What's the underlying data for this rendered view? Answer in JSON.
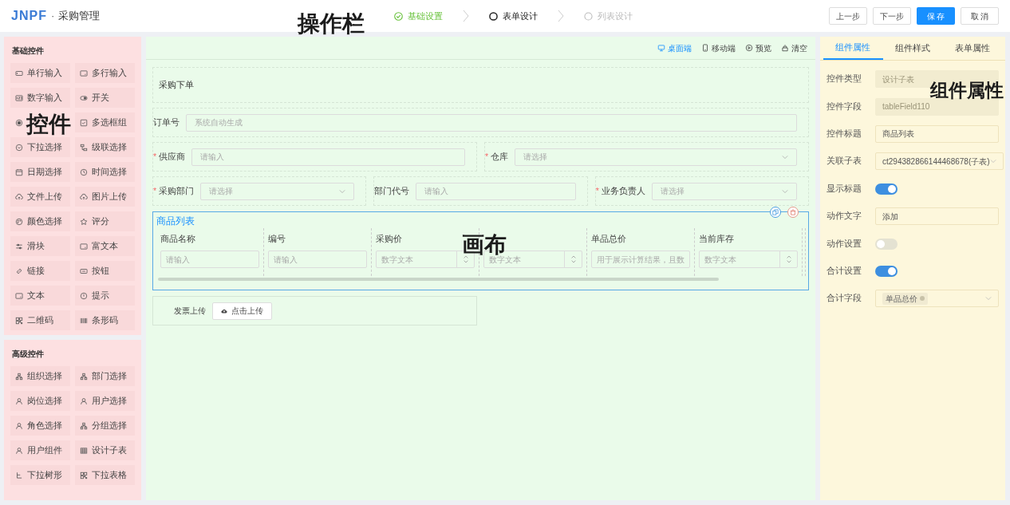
{
  "header": {
    "logo": "JNPF",
    "separator": "·",
    "title": "采购管理",
    "steps": [
      {
        "label": "基础设置",
        "done": true,
        "selected": false
      },
      {
        "label": "表单设计",
        "done": false,
        "selected": true
      },
      {
        "label": "列表设计",
        "done": false,
        "selected": false
      }
    ],
    "buttons": [
      {
        "label": "上一步",
        "primary": false
      },
      {
        "label": "下一步",
        "primary": false
      },
      {
        "label": "保 存",
        "primary": true
      },
      {
        "label": "取 消",
        "primary": false
      }
    ]
  },
  "palette": [
    {
      "title": "基础控件",
      "items": [
        {
          "label": "单行输入",
          "kind": "input"
        },
        {
          "label": "多行输入",
          "kind": "textarea"
        },
        {
          "label": "数字输入",
          "kind": "number"
        },
        {
          "label": "开关",
          "kind": "switch"
        },
        {
          "kind": "radio"
        },
        {
          "label": "多选框组",
          "kind": "checkbox"
        },
        {
          "label": "下拉选择",
          "kind": "dropdown"
        },
        {
          "label": "级联选择",
          "kind": "cascade"
        },
        {
          "label": "日期选择",
          "kind": "calendar"
        },
        {
          "label": "时间选择",
          "kind": "clock"
        },
        {
          "label": "文件上传",
          "kind": "upload"
        },
        {
          "label": "图片上传",
          "kind": "upload"
        },
        {
          "label": "颜色选择",
          "kind": "palette"
        },
        {
          "label": "评分",
          "kind": "star"
        },
        {
          "label": "滑块",
          "kind": "sliders"
        },
        {
          "label": "富文本",
          "kind": "textarea"
        },
        {
          "label": "链接",
          "kind": "link"
        },
        {
          "label": "按钮",
          "kind": "button"
        },
        {
          "label": "文本",
          "kind": "textarea"
        },
        {
          "label": "提示",
          "kind": "info"
        },
        {
          "label": "二维码",
          "kind": "qrcode"
        },
        {
          "label": "条形码",
          "kind": "barcode"
        }
      ]
    },
    {
      "title": "高级控件",
      "items": [
        {
          "label": "组织选择",
          "kind": "org"
        },
        {
          "label": "部门选择",
          "kind": "org"
        },
        {
          "label": "岗位选择",
          "kind": "user"
        },
        {
          "label": "用户选择",
          "kind": "user"
        },
        {
          "label": "角色选择",
          "kind": "user"
        },
        {
          "label": "分组选择",
          "kind": "org"
        },
        {
          "label": "用户组件",
          "kind": "user"
        },
        {
          "label": "设计子表",
          "kind": "table"
        },
        {
          "label": "下拉树形",
          "kind": "tree"
        },
        {
          "label": "下拉表格",
          "kind": "qrcode"
        }
      ]
    }
  ],
  "canvas": {
    "toolbar": [
      {
        "label": "桌面端",
        "kind": "monitor",
        "selected": true
      },
      {
        "label": "移动端",
        "kind": "phone",
        "selected": false
      },
      {
        "label": "预览",
        "kind": "play",
        "selected": false
      },
      {
        "label": "清空",
        "kind": "trash",
        "selected": false
      }
    ],
    "form_title": "采购下单",
    "rows": [
      [
        {
          "label": "订单号",
          "kind": "input",
          "placeholder": "系统自动生成"
        }
      ],
      [
        {
          "required_mark": "*",
          "label": "供应商",
          "kind": "input",
          "placeholder": "请输入"
        },
        {
          "required_mark": "*",
          "label": "仓库",
          "kind": "select",
          "placeholder": "请选择"
        }
      ],
      [
        {
          "required_mark": "*",
          "label": "采购部门",
          "kind": "select",
          "placeholder": "请选择"
        },
        {
          "label": "部门代号",
          "kind": "input",
          "placeholder": "请输入"
        },
        {
          "required_mark": "*",
          "label": "业务负责人",
          "kind": "select",
          "placeholder": "请选择"
        }
      ]
    ],
    "table": {
      "title": "商品列表",
      "columns": [
        {
          "header": "商品名称",
          "kind": "input",
          "placeholder": "请输入"
        },
        {
          "header": "编号",
          "kind": "input",
          "placeholder": "请输入"
        },
        {
          "header": "采购价",
          "kind": "number",
          "placeholder": "数字文本"
        },
        {
          "kind": "number",
          "placeholder": "数字文本"
        },
        {
          "header": "单品总价",
          "kind": "input",
          "placeholder": "用于展示计算结果，且数"
        },
        {
          "header": "当前库存",
          "kind": "number",
          "placeholder": "数字文本"
        }
      ]
    },
    "upload": {
      "label": "发票上传",
      "button": "点击上传"
    }
  },
  "properties": {
    "tabs": [
      {
        "label": "组件属性",
        "selected": true
      },
      {
        "label": "组件样式",
        "selected": false
      },
      {
        "label": "表单属性",
        "selected": false
      }
    ],
    "rows": [
      {
        "label": "控件类型",
        "kind": "input",
        "value": "设计子表",
        "disabled": true
      },
      {
        "label": "控件字段",
        "kind": "input",
        "value": "tableField110",
        "disabled": true
      },
      {
        "label": "控件标题",
        "kind": "input",
        "value": "商品列表",
        "disabled": false
      },
      {
        "label": "关联子表",
        "kind": "select",
        "value": "ct294382866144468678(子表)",
        "disabled": false
      },
      {
        "label": "显示标题",
        "kind": "switch",
        "on": true
      },
      {
        "label": "动作文字",
        "kind": "input",
        "value": "添加",
        "disabled": false
      },
      {
        "label": "动作设置",
        "kind": "switch",
        "on": false
      },
      {
        "label": "合计设置",
        "kind": "switch",
        "on": true
      },
      {
        "label": "合计字段",
        "kind": "tags",
        "value": "单品总价"
      }
    ]
  },
  "annotations": [
    "操作栏",
    "控件",
    "画布",
    "组件属性"
  ]
}
